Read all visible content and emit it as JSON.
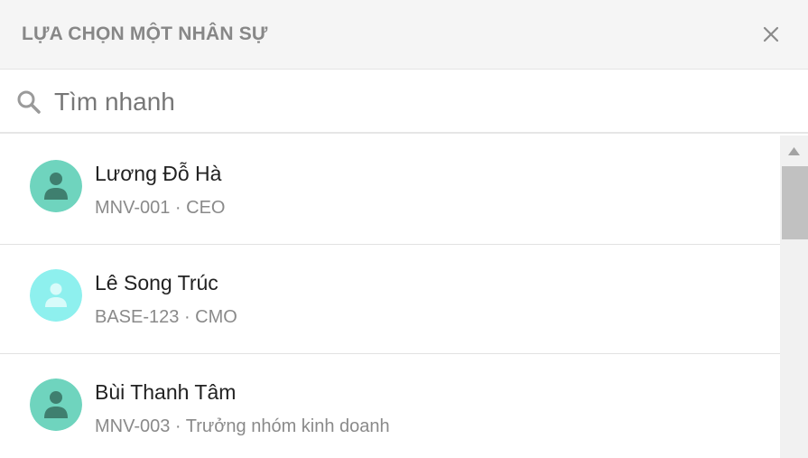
{
  "header": {
    "title": "LỰA CHỌN MỘT NHÂN SỰ",
    "close_icon": "close-icon"
  },
  "search": {
    "placeholder": "Tìm nhanh",
    "value": "",
    "icon": "search-icon"
  },
  "employees": [
    {
      "name": "Lương Đỗ Hà",
      "code": "MNV-001",
      "role": "CEO",
      "subtitle": "MNV-001 · CEO",
      "avatar_color": "#6fd4be",
      "avatar_icon": "person-icon"
    },
    {
      "name": "Lê Song Trúc",
      "code": "BASE-123",
      "role": "CMO",
      "subtitle": "BASE-123 · CMO",
      "avatar_color": "#8ef0ee",
      "avatar_icon": "person-icon"
    },
    {
      "name": "Bùi Thanh Tâm",
      "code": "MNV-003",
      "role": "Trưởng nhóm kinh doanh",
      "subtitle": "MNV-003 · Trưởng nhóm kinh doanh",
      "avatar_color": "#6fd4be",
      "avatar_icon": "person-icon"
    }
  ],
  "colors": {
    "header_bg": "#f5f5f5",
    "title_text": "#878787",
    "avatar_teal": "#6fd4be",
    "avatar_cyan": "#8ef0ee",
    "subtitle_text": "#8a8a8a"
  }
}
